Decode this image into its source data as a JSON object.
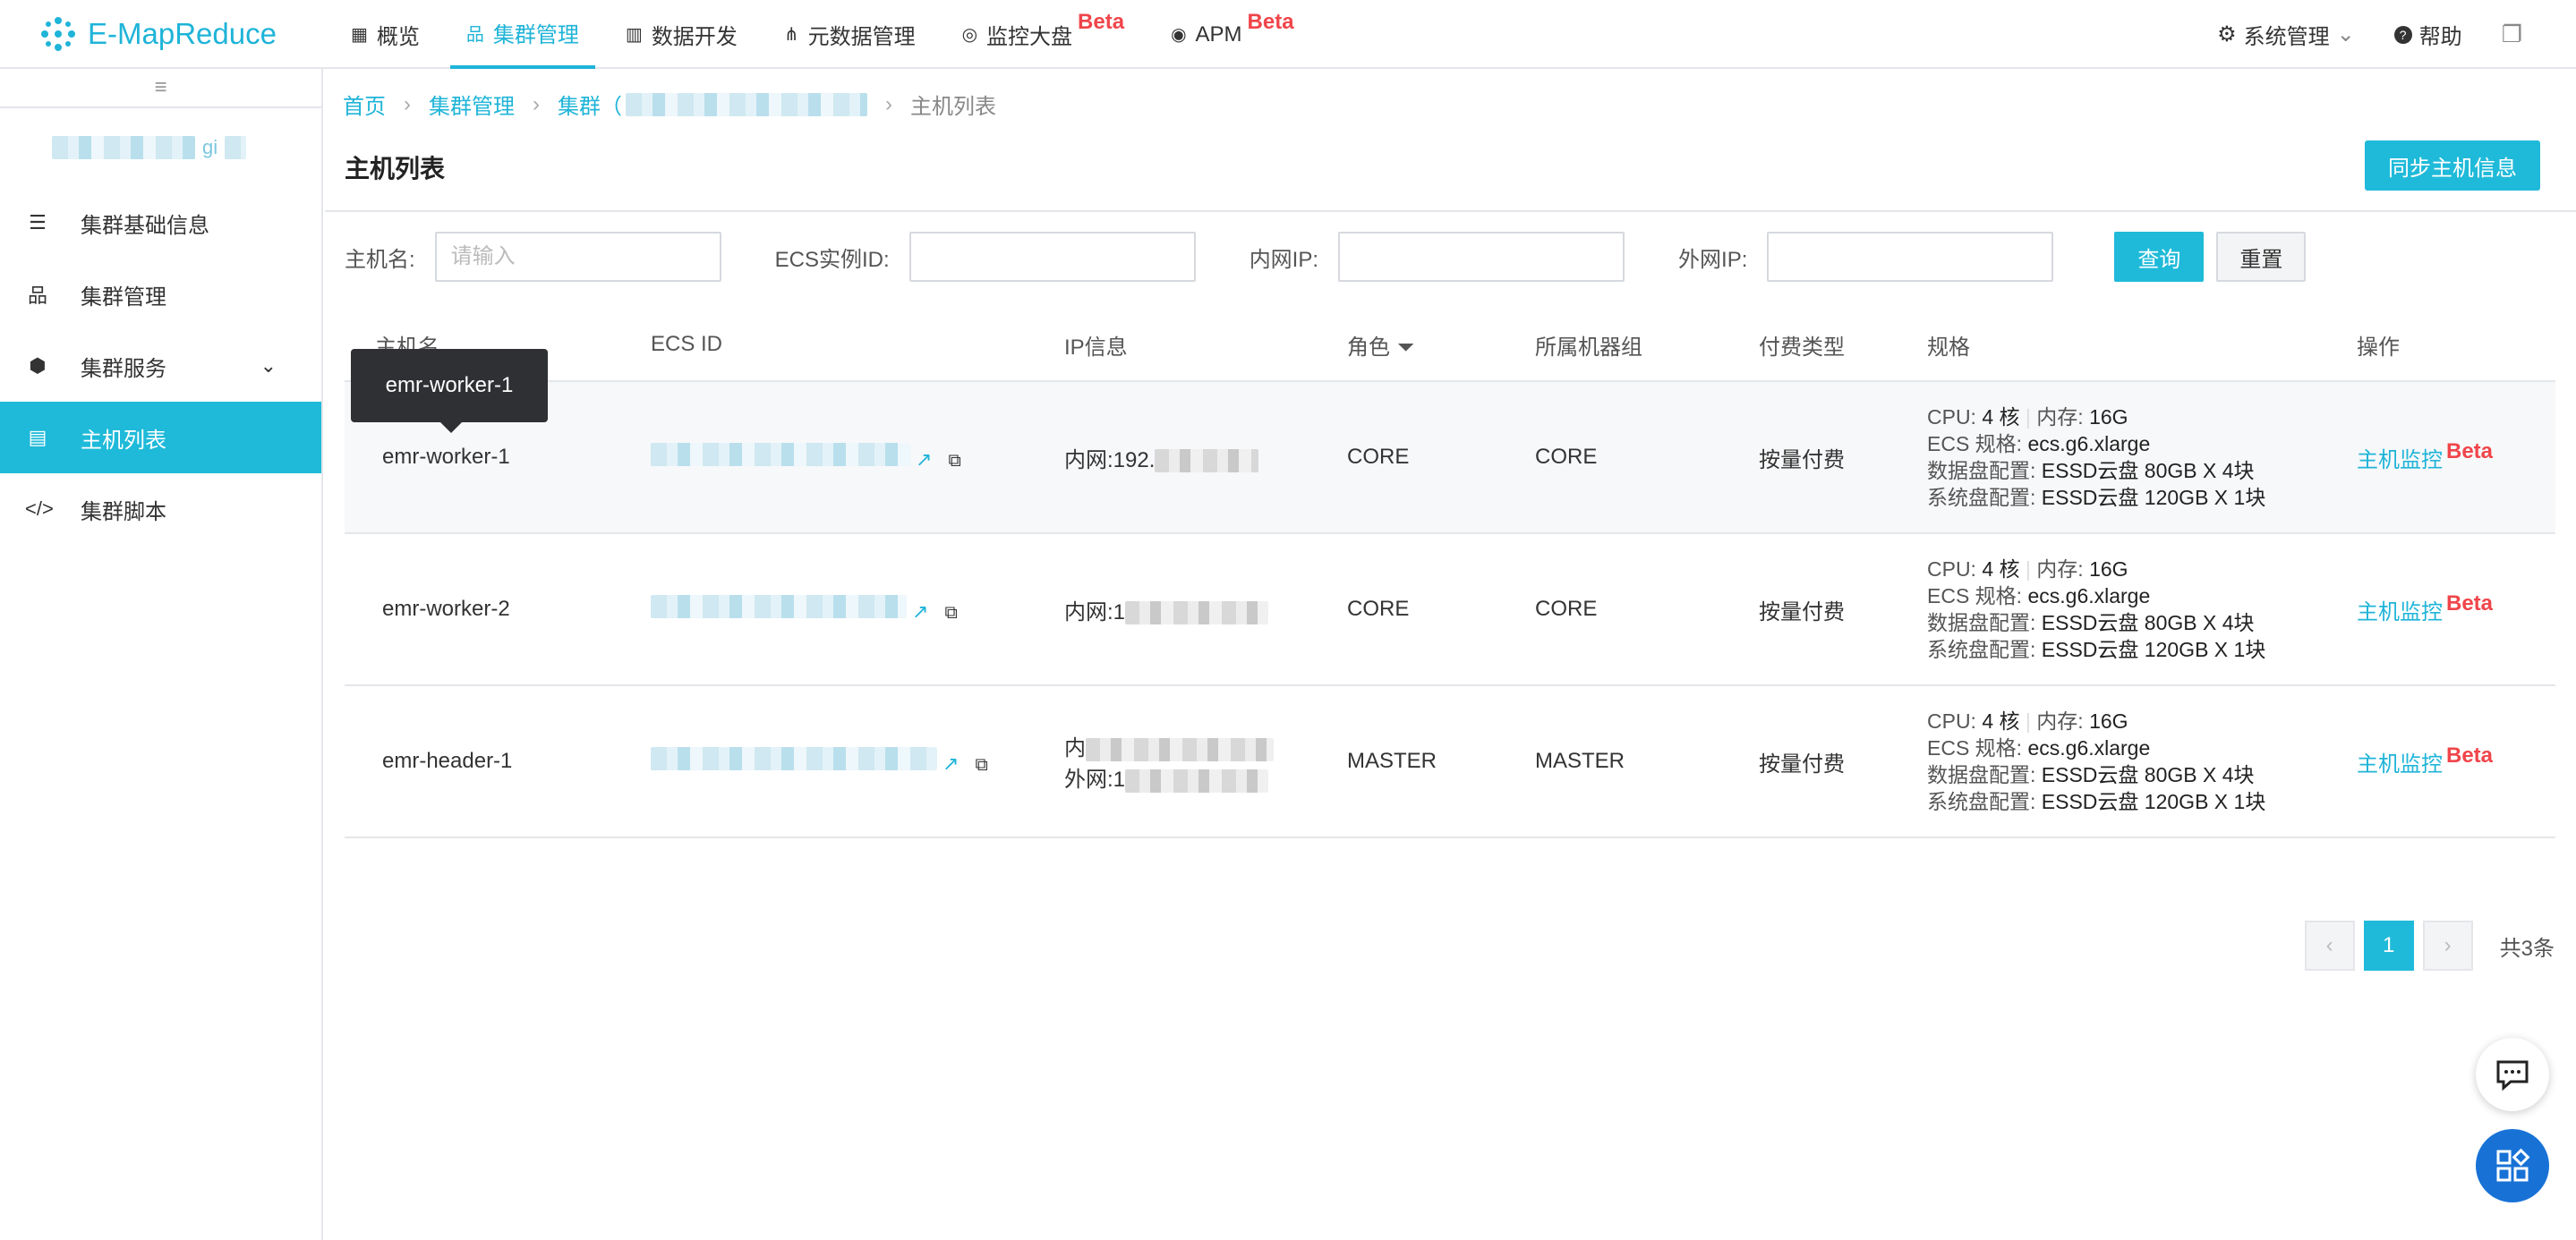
{
  "app": {
    "name": "E-MapReduce",
    "accent": "#1fb4d8",
    "beta_color": "#f0454a"
  },
  "nav": {
    "items": [
      {
        "label": "概览",
        "icon": "grid-icon"
      },
      {
        "label": "集群管理",
        "icon": "cluster-icon"
      },
      {
        "label": "数据开发",
        "icon": "bar-chart-icon"
      },
      {
        "label": "元数据管理",
        "icon": "share-icon"
      },
      {
        "label": "监控大盘",
        "icon": "monitor-icon",
        "badge": "Beta"
      },
      {
        "label": "APM",
        "icon": "apm-icon",
        "badge": "Beta"
      }
    ],
    "right": {
      "system": "系统管理",
      "help": "帮助"
    }
  },
  "sidebar": {
    "cluster_name_suffix": "gi",
    "items": [
      {
        "label": "集群基础信息",
        "icon": "list-icon"
      },
      {
        "label": "集群管理",
        "icon": "hierarchy-icon"
      },
      {
        "label": "集群服务",
        "icon": "cube-icon"
      },
      {
        "label": "主机列表",
        "icon": "server-icon"
      },
      {
        "label": "集群脚本",
        "icon": "code-icon"
      }
    ]
  },
  "breadcrumb": {
    "home": "首页",
    "cluster_mgmt": "集群管理",
    "cluster": "集群（",
    "current": "主机列表"
  },
  "page": {
    "title": "主机列表",
    "sync_button": "同步主机信息"
  },
  "filters": {
    "hostname_label": "主机名:",
    "hostname_placeholder": "请输入",
    "ecs_label": "ECS实例ID:",
    "private_ip_label": "内网IP:",
    "public_ip_label": "外网IP:",
    "query": "查询",
    "reset": "重置"
  },
  "table": {
    "headers": [
      "主机名",
      "ECS ID",
      "IP信息",
      "角色",
      "所属机器组",
      "付费类型",
      "规格",
      "操作"
    ],
    "rows": [
      {
        "host": "emr-worker-1",
        "ip1": "内网:192.",
        "ip2": "",
        "role": "CORE",
        "group": "CORE",
        "pay": "按量付费",
        "cpu_label": "CPU:",
        "cpu": "4 核",
        "mem_label": "内存:",
        "mem": "16G",
        "ecs_label": "ECS 规格:",
        "ecs": "ecs.g6.xlarge",
        "data_label": "数据盘配置:",
        "data": "ESSD云盘 80GB X 4块",
        "sys_label": "系统盘配置:",
        "sys": "ESSD云盘 120GB X 1块",
        "op": "主机监控",
        "op_badge": "Beta"
      },
      {
        "host": "emr-worker-2",
        "ip1": "内网:1",
        "ip2": "",
        "role": "CORE",
        "group": "CORE",
        "pay": "按量付费",
        "cpu_label": "CPU:",
        "cpu": "4 核",
        "mem_label": "内存:",
        "mem": "16G",
        "ecs_label": "ECS 规格:",
        "ecs": "ecs.g6.xlarge",
        "data_label": "数据盘配置:",
        "data": "ESSD云盘 80GB X 4块",
        "sys_label": "系统盘配置:",
        "sys": "ESSD云盘 120GB X 1块",
        "op": "主机监控",
        "op_badge": "Beta"
      },
      {
        "host": "emr-header-1",
        "ip1": "内",
        "ip2": "外网:1",
        "role": "MASTER",
        "group": "MASTER",
        "pay": "按量付费",
        "cpu_label": "CPU:",
        "cpu": "4 核",
        "mem_label": "内存:",
        "mem": "16G",
        "ecs_label": "ECS 规格:",
        "ecs": "ecs.g6.xlarge",
        "data_label": "数据盘配置:",
        "data": "ESSD云盘 80GB X 4块",
        "sys_label": "系统盘配置:",
        "sys": "ESSD云盘 120GB X 1块",
        "op": "主机监控",
        "op_badge": "Beta"
      }
    ]
  },
  "tooltip": {
    "text": "emr-worker-1"
  },
  "pagination": {
    "prev": "‹",
    "current": "1",
    "next": "›",
    "total": "共3条"
  }
}
